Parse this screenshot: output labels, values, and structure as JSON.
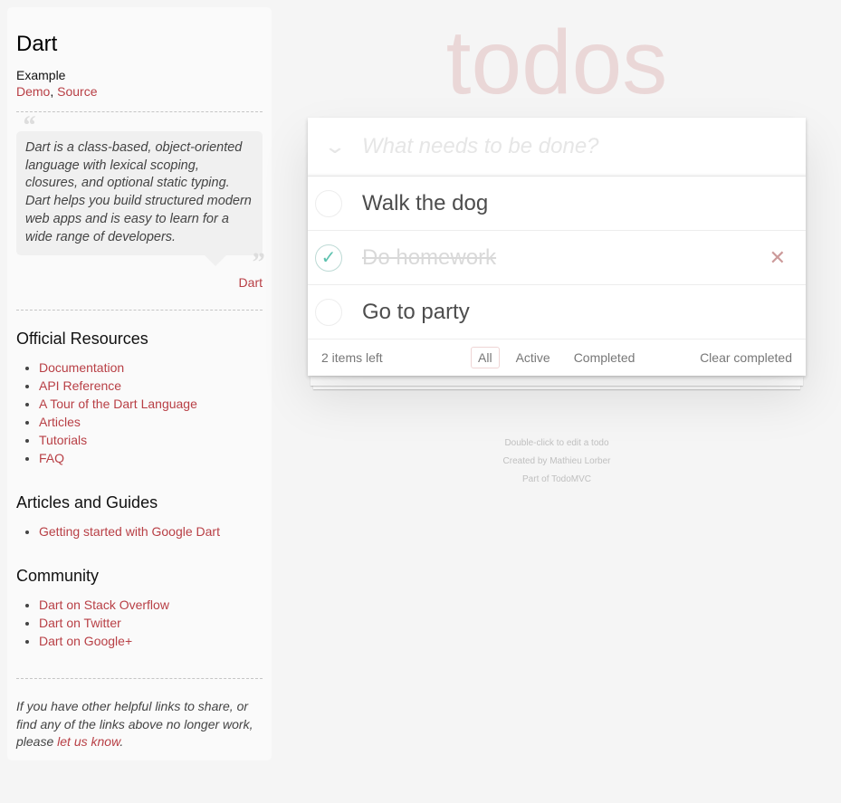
{
  "sidebar": {
    "title": "Dart",
    "example_label": "Example",
    "demo": "Demo",
    "source": "Source",
    "quote": "Dart is a class-based, object-oriented language with lexical scoping, closures, and optional static typing. Dart helps you build structured modern web apps and is easy to learn for a wide range of developers.",
    "quote_author": "Dart",
    "sections": [
      {
        "title": "Official Resources",
        "links": [
          "Documentation",
          "API Reference",
          "A Tour of the Dart Language",
          "Articles",
          "Tutorials",
          "FAQ"
        ]
      },
      {
        "title": "Articles and Guides",
        "links": [
          "Getting started with Google Dart"
        ]
      },
      {
        "title": "Community",
        "links": [
          "Dart on Stack Overflow",
          "Dart on Twitter",
          "Dart on Google+"
        ]
      }
    ],
    "footer_text": "If you have other helpful links to share, or find any of the links above no longer work, please ",
    "footer_link": "let us know",
    "footer_end": "."
  },
  "app": {
    "title": "todos",
    "placeholder": "What needs to be done?",
    "todos": [
      {
        "title": "Walk the dog",
        "completed": false
      },
      {
        "title": "Do homework",
        "completed": true
      },
      {
        "title": "Go to party",
        "completed": false
      }
    ],
    "items_left": "2 items left",
    "filters": [
      "All",
      "Active",
      "Completed"
    ],
    "selected_filter": "All",
    "clear_completed": "Clear completed"
  },
  "info": [
    "Double-click to edit a todo",
    "Created by Mathieu Lorber",
    "Part of TodoMVC"
  ]
}
